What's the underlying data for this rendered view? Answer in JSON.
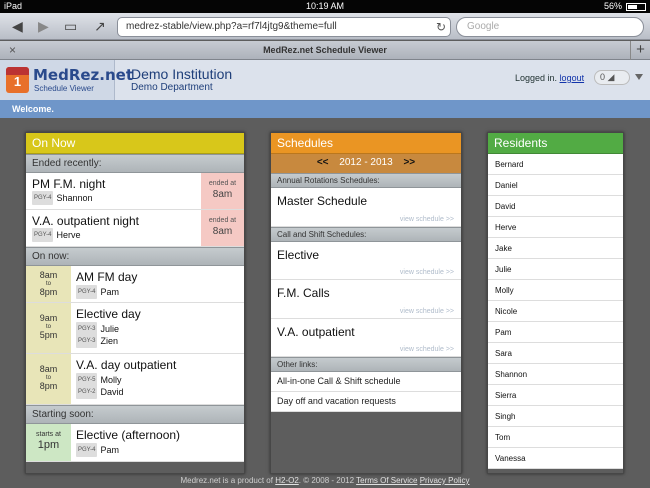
{
  "status": {
    "device": "iPad",
    "time": "10:19 AM",
    "battery": "56%"
  },
  "browser": {
    "url": "medrez-stable/view.php?a=rf7l4jtg9&theme=full",
    "search_placeholder": "Google",
    "tab_title": "MedRez.net Schedule Viewer"
  },
  "header": {
    "logo_badge": "1",
    "logo_main": "MedRez.net",
    "logo_sub": "Schedule Viewer",
    "institution": "Demo Institution",
    "department": "Demo Department",
    "logged_in": "Logged in.",
    "logout": "logout",
    "notif_count": "0"
  },
  "welcome": "Welcome.",
  "on_now": {
    "title": "On Now",
    "ended_label": "Ended recently:",
    "on_label": "On now:",
    "soon_label": "Starting soon:",
    "ended": [
      {
        "title": "PM F.M. night",
        "people": [
          {
            "pgy": "PGY-4",
            "name": "Shannon"
          }
        ],
        "ended_at": "ended at",
        "time": "8am"
      },
      {
        "title": "V.A. outpatient night",
        "people": [
          {
            "pgy": "PGY-4",
            "name": "Herve"
          }
        ],
        "ended_at": "ended at",
        "time": "8am"
      }
    ],
    "current": [
      {
        "start": "8am",
        "to": "to",
        "end": "8pm",
        "title": "AM FM day",
        "people": [
          {
            "pgy": "PGY-4",
            "name": "Pam"
          }
        ]
      },
      {
        "start": "9am",
        "to": "to",
        "end": "5pm",
        "title": "Elective day",
        "people": [
          {
            "pgy": "PGY-3",
            "name": "Julie"
          },
          {
            "pgy": "PGY-3",
            "name": "Zien"
          }
        ]
      },
      {
        "start": "8am",
        "to": "to",
        "end": "8pm",
        "title": "V.A. day outpatient",
        "people": [
          {
            "pgy": "PGY-5",
            "name": "Molly"
          },
          {
            "pgy": "PGY-2",
            "name": "David"
          }
        ]
      }
    ],
    "soon": [
      {
        "starts_at": "starts at",
        "time": "1pm",
        "title": "Elective (afternoon)",
        "people": [
          {
            "pgy": "PGY-4",
            "name": "Pam"
          }
        ]
      }
    ]
  },
  "schedules": {
    "title": "Schedules",
    "prev": "<<",
    "year": "2012 - 2013",
    "next": ">>",
    "annual_label": "Annual Rotations Schedules:",
    "call_label": "Call and Shift Schedules:",
    "other_label": "Other links:",
    "view_label": "view schedule >>",
    "annual": [
      "Master Schedule"
    ],
    "call": [
      "Elective",
      "F.M. Calls",
      "V.A. outpatient"
    ],
    "links": [
      "All-in-one Call & Shift schedule",
      "Day off and vacation requests"
    ]
  },
  "residents": {
    "title": "Residents",
    "names": [
      "Bernard",
      "Daniel",
      "David",
      "Herve",
      "Jake",
      "Julie",
      "Molly",
      "Nicole",
      "Pam",
      "Sara",
      "Shannon",
      "Sierra",
      "Singh",
      "Tom",
      "Vanessa"
    ]
  },
  "footer": {
    "text": "Medrez.net is a product of",
    "company": "H2-O2",
    "copyright": ". © 2008 - 2012",
    "terms": "Terms Of Service",
    "privacy": "Privacy Policy"
  },
  "colors": {
    "on_now": "#d8c71a",
    "schedules": "#ea9523",
    "residents": "#52ab44",
    "welcome_bar": "#6f96c9"
  }
}
